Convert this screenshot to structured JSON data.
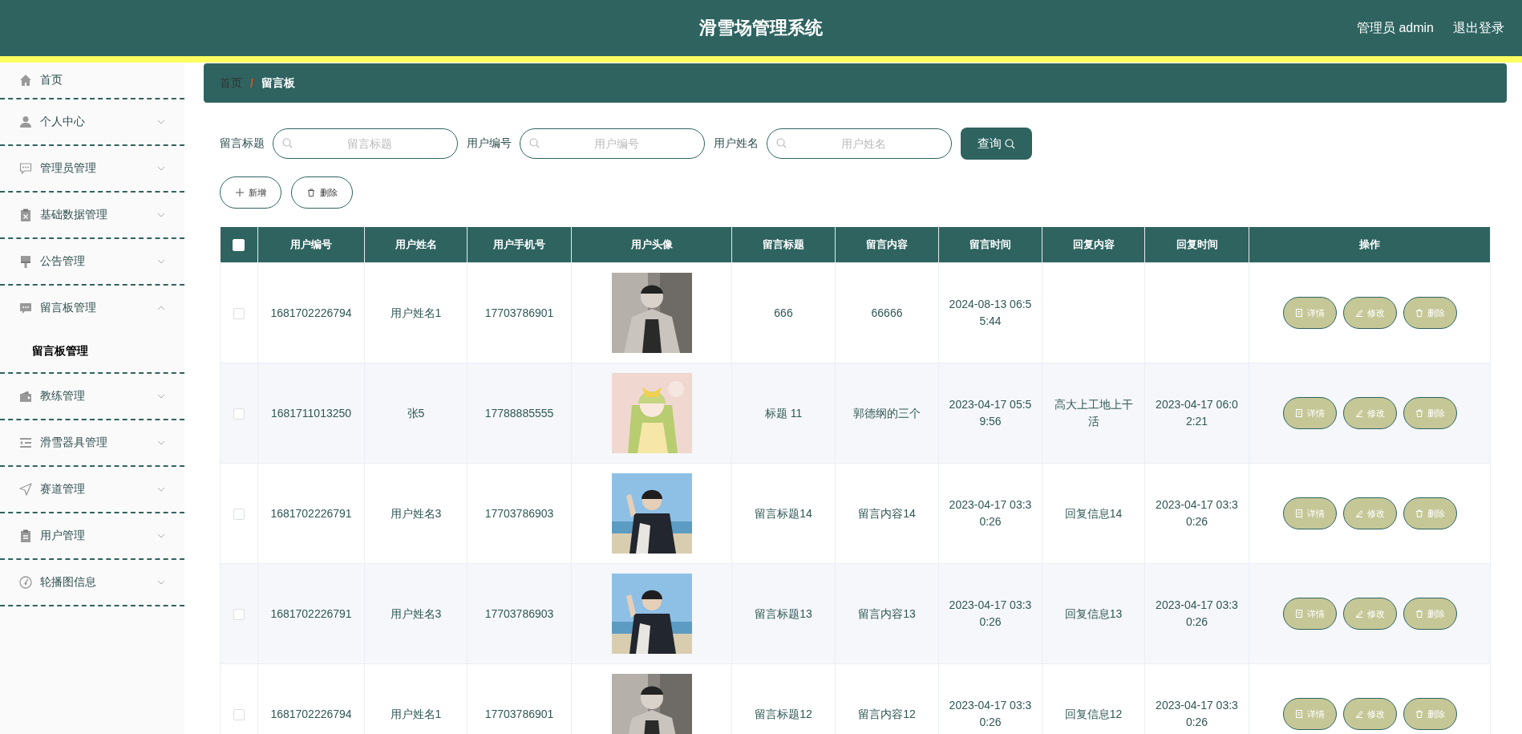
{
  "header": {
    "title": "滑雪场管理系统",
    "user": "管理员 admin",
    "logout": "退出登录"
  },
  "sidebar": {
    "items": [
      {
        "label": "首页",
        "kind": "link"
      },
      {
        "label": "个人中心",
        "kind": "menu",
        "expanded": false
      },
      {
        "label": "管理员管理",
        "kind": "menu",
        "expanded": false
      },
      {
        "label": "基础数据管理",
        "kind": "menu",
        "expanded": false
      },
      {
        "label": "公告管理",
        "kind": "menu",
        "expanded": false
      },
      {
        "label": "留言板管理",
        "kind": "menu",
        "expanded": true,
        "children": [
          {
            "label": "留言板管理",
            "selected": true
          }
        ]
      },
      {
        "label": "教练管理",
        "kind": "menu",
        "expanded": false
      },
      {
        "label": "滑雪器具管理",
        "kind": "menu",
        "expanded": false
      },
      {
        "label": "赛道管理",
        "kind": "menu",
        "expanded": false
      },
      {
        "label": "用户管理",
        "kind": "menu",
        "expanded": false
      },
      {
        "label": "轮播图信息",
        "kind": "menu",
        "expanded": false
      }
    ]
  },
  "breadcrumb": {
    "items": [
      "首页",
      "留言板"
    ],
    "separator": "/"
  },
  "search": {
    "fields": [
      {
        "label": "留言标题",
        "placeholder": "留言标题"
      },
      {
        "label": "用户编号",
        "placeholder": "用户编号"
      },
      {
        "label": "用户姓名",
        "placeholder": "用户姓名"
      }
    ],
    "button": "查询"
  },
  "toolbar": {
    "buttons": [
      "新增",
      "删除"
    ]
  },
  "table": {
    "select_all": {
      "checked": false
    },
    "columns": [
      "用户编号",
      "用户姓名",
      "用户手机号",
      "用户头像",
      "留言标题",
      "留言内容",
      "留言时间",
      "回复内容",
      "回复时间",
      "操作"
    ],
    "rows": [
      {
        "checked": false,
        "user_id": "1681702226794",
        "user_name": "用户姓名1",
        "phone": "17703786901",
        "title": "666",
        "content": "66666",
        "time": "2024-08-13 06:55:44",
        "actions": [
          "详情",
          "修改",
          "删除"
        ]
      },
      {
        "checked": false,
        "user_id": "1681711013250",
        "user_name": "张5",
        "phone": "17788885555",
        "title": "标题 11",
        "content": "郭德纲的三个",
        "time": "2023-04-17 05:59:56",
        "reply": "高大上工地上干活",
        "reply_time": "2023-04-17 06:02:21",
        "actions": [
          "详情",
          "修改",
          "删除"
        ]
      },
      {
        "checked": false,
        "user_id": "1681702226791",
        "user_name": "用户姓名3",
        "phone": "17703786903",
        "title": "留言标题14",
        "content": "留言内容14",
        "time": "2023-04-17 03:30:26",
        "reply": "回复信息14",
        "reply_time": "2023-04-17 03:30:26",
        "actions": [
          "详情",
          "修改",
          "删除"
        ]
      },
      {
        "checked": false,
        "user_id": "1681702226791",
        "user_name": "用户姓名3",
        "phone": "17703786903",
        "title": "留言标题13",
        "content": "留言内容13",
        "time": "2023-04-17 03:30:26",
        "reply": "回复信息13",
        "reply_time": "2023-04-17 03:30:26",
        "actions": [
          "详情",
          "修改",
          "删除"
        ]
      },
      {
        "checked": false,
        "user_id": "1681702226794",
        "user_name": "用户姓名1",
        "phone": "17703786901",
        "title": "留言标题12",
        "content": "留言内容12",
        "time": "2023-04-17 03:30:26",
        "reply": "回复信息12",
        "reply_time": "2023-04-17 03:30:26",
        "actions": [
          "详情",
          "修改",
          "删除"
        ]
      }
    ]
  }
}
